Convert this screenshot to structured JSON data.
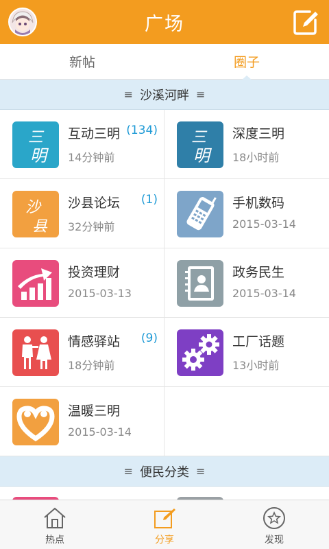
{
  "header": {
    "title": "广场",
    "colors": {
      "accent": "#f39c1f",
      "badge": "#1e9ad6",
      "section_bg": "#dcecf7"
    }
  },
  "tabs": [
    {
      "label": "新帖",
      "active": false
    },
    {
      "label": "圈子",
      "active": true
    }
  ],
  "sections": [
    {
      "title": "沙溪河畔",
      "prefix": "≡",
      "suffix": "≡"
    },
    {
      "title": "便民分类",
      "prefix": "≡",
      "suffix": "≡"
    }
  ],
  "circles": [
    {
      "name": "互动三明",
      "time": "14分钟前",
      "count": "(134)",
      "icon": "hudong-sanming-icon"
    },
    {
      "name": "深度三明",
      "time": "18小时前",
      "count": "",
      "icon": "shendu-sanming-icon"
    },
    {
      "name": "沙县论坛",
      "time": "32分钟前",
      "count": "(1)",
      "icon": "shaxian-forum-icon"
    },
    {
      "name": "手机数码",
      "time": "2015-03-14",
      "count": "",
      "icon": "mobile-phone-icon"
    },
    {
      "name": "投资理财",
      "time": "2015-03-13",
      "count": "",
      "icon": "investment-chart-icon"
    },
    {
      "name": "政务民生",
      "time": "2015-03-14",
      "count": "",
      "icon": "address-book-icon"
    },
    {
      "name": "情感驿站",
      "time": "18分钟前",
      "count": "(9)",
      "icon": "couple-icon"
    },
    {
      "name": "工厂话题",
      "time": "13小时前",
      "count": "",
      "icon": "gears-icon"
    },
    {
      "name": "温暖三明",
      "time": "2015-03-14",
      "count": "",
      "icon": "heart-hands-icon"
    }
  ],
  "icon_text": {
    "hudong": "三明",
    "shendu": "三明",
    "shaxian": "沙县"
  },
  "bottom_nav": [
    {
      "label": "热点",
      "active": false,
      "icon": "house-icon"
    },
    {
      "label": "分享",
      "active": true,
      "icon": "compose-icon"
    },
    {
      "label": "发现",
      "active": false,
      "icon": "star-circle-icon"
    }
  ]
}
